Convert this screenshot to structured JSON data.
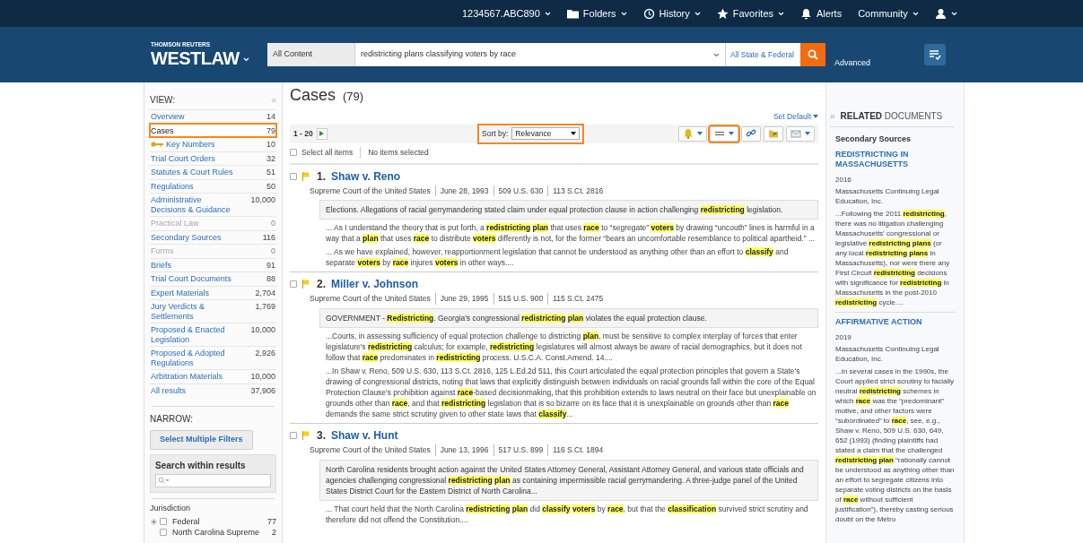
{
  "top_nav": [
    {
      "label": "1234567.ABC890",
      "kind": "plain",
      "dropdown": true
    },
    {
      "label": "Folders",
      "kind": "folder",
      "dropdown": true
    },
    {
      "label": "History",
      "kind": "history",
      "dropdown": true
    },
    {
      "label": "Favorites",
      "kind": "star",
      "dropdown": true
    },
    {
      "label": "Alerts",
      "kind": "bell",
      "dropdown": false
    },
    {
      "label": "Community",
      "kind": "plain",
      "dropdown": true
    },
    {
      "kind": "user",
      "dropdown": true
    }
  ],
  "header": {
    "brand_top": "THOMSON REUTERS",
    "brand": "WESTLAW",
    "scope": "All Content",
    "query": "redistricting plans classifying voters by race",
    "jurisdiction": "All State & Federal",
    "advanced": "Advanced"
  },
  "sidebar": {
    "view_label": "VIEW:",
    "collapse_glyph": "«",
    "views": [
      {
        "label": "Overview",
        "count": "14",
        "selected": false,
        "disabled": false,
        "outlined": false,
        "kind": "plain"
      },
      {
        "label": "Cases",
        "count": "79",
        "selected": true,
        "disabled": false,
        "outlined": true,
        "kind": "plain"
      },
      {
        "label": "Key Numbers",
        "count": "10",
        "selected": false,
        "disabled": false,
        "outlined": false,
        "kind": "key"
      },
      {
        "label": "Trial Court Orders",
        "count": "32",
        "selected": false,
        "disabled": false,
        "outlined": false,
        "kind": "plain"
      },
      {
        "label": "Statutes & Court Rules",
        "count": "51",
        "selected": false,
        "disabled": false,
        "outlined": false,
        "kind": "plain"
      },
      {
        "label": "Regulations",
        "count": "50",
        "selected": false,
        "disabled": false,
        "outlined": false,
        "kind": "plain"
      },
      {
        "label": "Administrative Decisions & Guidance",
        "count": "10,000",
        "selected": false,
        "disabled": false,
        "outlined": false,
        "kind": "plain"
      },
      {
        "label": "Practical Law",
        "count": "0",
        "selected": false,
        "disabled": true,
        "outlined": false,
        "kind": "plain"
      },
      {
        "label": "Secondary Sources",
        "count": "116",
        "selected": false,
        "disabled": false,
        "outlined": false,
        "kind": "plain"
      },
      {
        "label": "Forms",
        "count": "0",
        "selected": false,
        "disabled": true,
        "outlined": false,
        "kind": "plain"
      },
      {
        "label": "Briefs",
        "count": "91",
        "selected": false,
        "disabled": false,
        "outlined": false,
        "kind": "plain"
      },
      {
        "label": "Trial Court Documents",
        "count": "88",
        "selected": false,
        "disabled": false,
        "outlined": false,
        "kind": "plain"
      },
      {
        "label": "Expert Materials",
        "count": "2,704",
        "selected": false,
        "disabled": false,
        "outlined": false,
        "kind": "plain"
      },
      {
        "label": "Jury Verdicts & Settlements",
        "count": "1,769",
        "selected": false,
        "disabled": false,
        "outlined": false,
        "kind": "plain"
      },
      {
        "label": "Proposed & Enacted Legislation",
        "count": "10,000",
        "selected": false,
        "disabled": false,
        "outlined": false,
        "kind": "plain"
      },
      {
        "label": "Proposed & Adopted Regulations",
        "count": "2,926",
        "selected": false,
        "disabled": false,
        "outlined": false,
        "kind": "plain"
      },
      {
        "label": "Arbitration Materials",
        "count": "10,000",
        "selected": false,
        "disabled": false,
        "outlined": false,
        "kind": "plain"
      },
      {
        "label": "All results",
        "count": "37,906",
        "selected": false,
        "disabled": false,
        "outlined": false,
        "kind": "plain"
      }
    ],
    "narrow_label": "NARROW:",
    "filter_button": "Select Multiple Filters",
    "search_within": "Search within results",
    "jurisdiction_label": "Jurisdiction",
    "jurisdictions": [
      {
        "label": "Federal",
        "count": "77",
        "expandable": true,
        "checked": false
      },
      {
        "label": "North Carolina Supreme",
        "count": "2",
        "expandable": false,
        "checked": false
      }
    ]
  },
  "main": {
    "title": "Cases",
    "count": "(79)",
    "set_default": "Set Default",
    "range": "1 - 20",
    "sort": {
      "label": "Sort by:",
      "value": "Relevance",
      "outlined": true
    },
    "tools": [
      {
        "kind": "bell",
        "dropdown": true,
        "outlined": false
      },
      {
        "kind": "lines",
        "dropdown": true,
        "outlined": true
      },
      {
        "kind": "link",
        "dropdown": false,
        "outlined": false
      },
      {
        "kind": "folder",
        "dropdown": false,
        "outlined": false
      },
      {
        "kind": "mail",
        "dropdown": true,
        "outlined": false
      }
    ],
    "select_all": "Select all items",
    "select_all_checked": false,
    "selection_status": "No items selected",
    "results": [
      {
        "number": "1.",
        "title": "Shaw v. Reno",
        "checked": false,
        "meta": [
          "Supreme Court of the United States",
          "June 28, 1993",
          "509 U.S. 630",
          "113 S.Ct. 2816"
        ],
        "summary": "Elections. Allegations of racial gerrymandering stated claim under equal protection clause in action challenging **redistricting** legislation.",
        "snippets": [
          "...   As I understand the theory that is put forth, a **redistricting** **plan** that uses **race** to “segregate” **voters** by drawing “uncouth” lines is harmful in a way that a **plan** that uses **race** to distribute **voters** differently is not, for the former “bears an uncomfortable resemblance to political apartheid.”   ...",
          "...   As we have explained, however, reapportionment legislation that cannot be understood as anything other than an effort to **classify** and separate **voters** by **race** injures **voters** in other ways...."
        ]
      },
      {
        "number": "2.",
        "title": "Miller v. Johnson",
        "checked": false,
        "meta": [
          "Supreme Court of the United States",
          "June 29, 1995",
          "515 U.S. 900",
          "115 S.Ct. 2475"
        ],
        "summary": "GOVERNMENT - **Redistricting**. Georgia's congressional **redistricting** **plan** violates the equal protection clause.",
        "snippets": [
          "...Courts, in assessing sufficiency of equal protection challenge to districting **plan**, must be sensitive to complex interplay of forces that enter legislature's **redistricting** calculus;  for example, **redistricting** legislatures will almost always be aware of racial demographics, but it does not follow that **race** predominates in **redistricting** process.    U.S.C.A. Const.Amend. 14....",
          "...In Shaw v. Reno, 509 U.S. 630, 113 S.Ct. 2816, 125 L.Ed.2d 511, this Court articulated the equal protection principles that govern a State's drawing of congressional districts, noting that laws that explicitly distinguish between individuals on racial grounds fall within the core of the Equal Protection Clause's prohibition against **race**-based decisionmaking, that this prohibition extends to laws neutral on their face but unexplainable on grounds other than **race**, and that **redistricting** legislation that is so bizarre on its face that it is unexplainable on grounds other than **race** demands the same strict scrutiny given to other state laws that **classify**..."
        ]
      },
      {
        "number": "3.",
        "title": "Shaw v. Hunt",
        "checked": false,
        "meta": [
          "Supreme Court of the United States",
          "June 13, 1996",
          "517 U.S. 899",
          "116 S.Ct. 1894"
        ],
        "summary": "North Carolina residents brought action against the United States Attorney General, Assistant Attorney General, and various state officials and agencies challenging congressional **redistricting** **plan** as containing impermissible racial gerrymandering. A three-judge panel of the United States District Court for the Eastern District of North Carolina...",
        "snippets": [
          "...    That court held that the North Carolina **redistricting** **plan** did **classify**   **voters** by **race**, but that the **classification** survived strict scrutiny and therefore did not offend the Constitution...."
        ]
      }
    ]
  },
  "related": {
    "expand_glyph": "»",
    "heading": "**RELATED** DOCUMENTS",
    "section": "Secondary Sources",
    "documents": [
      {
        "title": "REDISTRICTING IN MASSACHUSETTS",
        "year": "2016",
        "publisher": "Massachusetts Continuing Legal Education, Inc.",
        "snippet": "...Following the 2011 **redistricting**, there was no litigation challenging Massachusetts' congressional or legislative **redistricting** **plans** (or any local **redistricting** **plans** in Massachusetts), nor were there any First Circuit **redistricting** decisions with significance for **redistricting** in Massachusetts in the post-2010 **redistricting** cycle...."
      },
      {
        "title": "AFFIRMATIVE ACTION",
        "year": "2019",
        "publisher": "Massachusetts Continuing Legal Education, Inc.",
        "snippet": "...In several cases in the 1990s, the Court applied strict scrutiny to facially neutral **redistricting** schemes in which **race** was the “predominant” motive, and other factors were “subordinated” to **race**, see, e.g., Shaw v. Reno, 509 U.S. 630, 649, 652 (1993) (finding plaintiffs had stated a claim that the challenged **redistricting** **plan** “rationally cannot be understood as anything other than an effort to segregate citizens into separate voting districts on the basis of **race** without sufficient justification”), thereby casting serious doubt on the Metro"
      }
    ]
  }
}
